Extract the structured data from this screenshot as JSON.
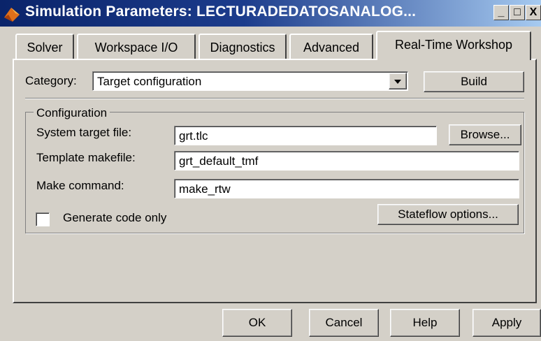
{
  "window": {
    "title": "Simulation Parameters: LECTURADEDATOSANALOG...",
    "minimize_symbol": "_",
    "maximize_symbol": "□",
    "close_symbol": "X",
    "icon": "matlab-icon"
  },
  "tabs": [
    {
      "label": "Solver",
      "active": false
    },
    {
      "label": "Workspace I/O",
      "active": false
    },
    {
      "label": "Diagnostics",
      "active": false
    },
    {
      "label": "Advanced",
      "active": false
    },
    {
      "label": "Real-Time Workshop",
      "active": true
    }
  ],
  "category": {
    "label": "Category:",
    "value": "Target configuration",
    "build_label": "Build"
  },
  "configuration": {
    "group_title": "Configuration",
    "system_target_label": "System target file:",
    "system_target_value": "grt.tlc",
    "browse_label": "Browse...",
    "template_label": "Template makefile:",
    "template_value": "grt_default_tmf",
    "make_label": "Make command:",
    "make_value": "make_rtw",
    "generate_code_label": "Generate code only",
    "generate_code_checked": false,
    "stateflow_label": "Stateflow options..."
  },
  "footer": {
    "ok_label": "OK",
    "cancel_label": "Cancel",
    "help_label": "Help",
    "apply_label": "Apply"
  },
  "colors": {
    "face": "#d4d0c8",
    "titlebar_start": "#0a246a",
    "titlebar_end": "#a6caf0"
  }
}
